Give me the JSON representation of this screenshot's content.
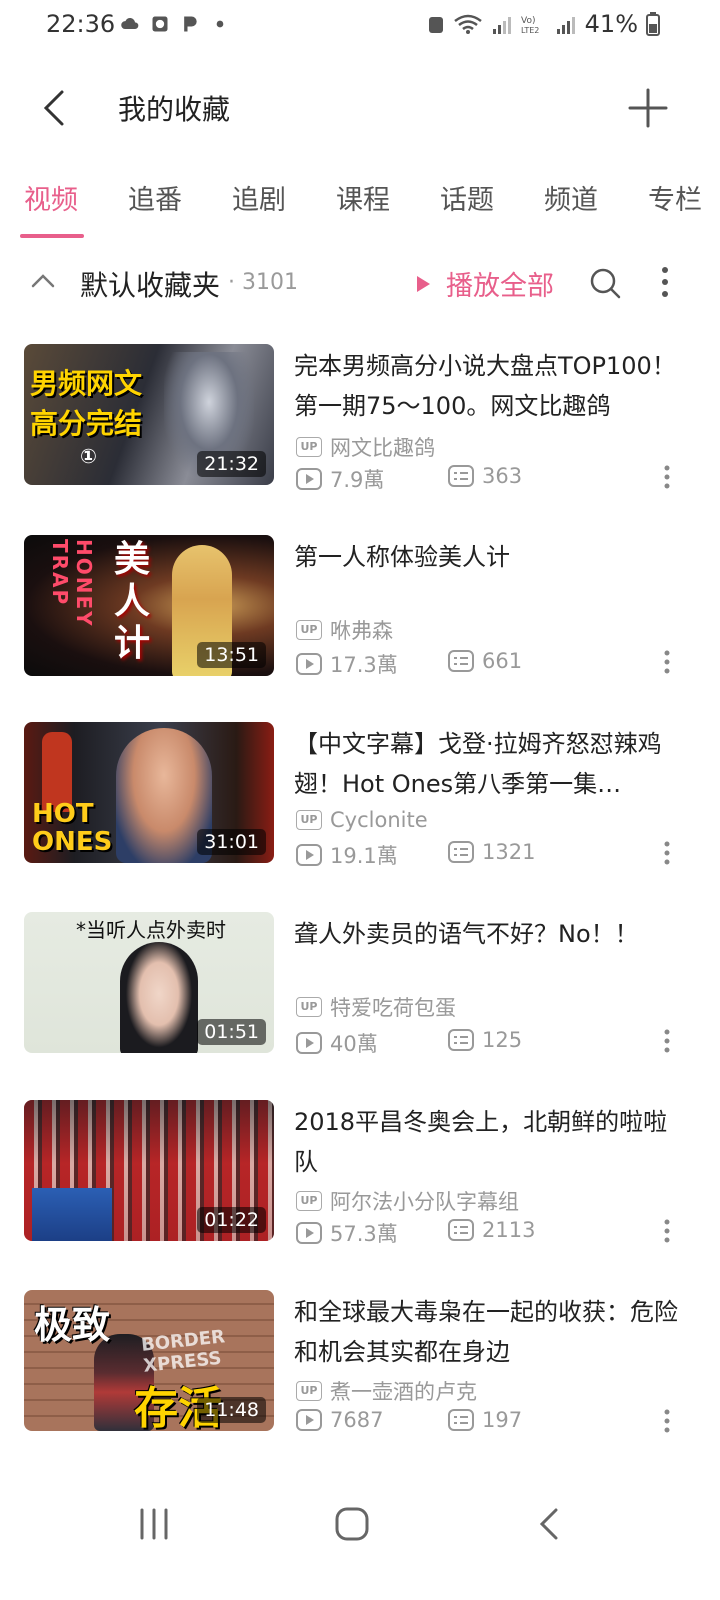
{
  "status_bar": {
    "time": "22:36",
    "battery": "41%",
    "left_icons": [
      "cloud-icon",
      "clock-app-icon",
      "p-app-icon",
      "dot-icon"
    ],
    "right_icons": [
      "alarm-icon",
      "wifi-icon",
      "signal-r-icon",
      "volte-icon",
      "signal-icon",
      "battery-icon"
    ]
  },
  "header": {
    "title": "我的收藏"
  },
  "tabs": [
    {
      "label": "视频",
      "active": true
    },
    {
      "label": "追番",
      "active": false
    },
    {
      "label": "追剧",
      "active": false
    },
    {
      "label": "课程",
      "active": false
    },
    {
      "label": "话题",
      "active": false
    },
    {
      "label": "频道",
      "active": false
    },
    {
      "label": "专栏",
      "active": false
    }
  ],
  "folder": {
    "name": "默认收藏夹",
    "count": "· 3101",
    "play_all": "播放全部"
  },
  "videos": [
    {
      "title": "完本男频高分小说大盘点TOP100！第一期75～100。网文比趣鸽",
      "up": "网文比趣鸽",
      "views": "7.9萬",
      "comments": "363",
      "duration": "21:32"
    },
    {
      "title": "第一人称体验美人计",
      "up": "咻弗森",
      "views": "17.3萬",
      "comments": "661",
      "duration": "13:51"
    },
    {
      "title": "【中文字幕】戈登·拉姆齐怒怼辣鸡翅！Hot Ones第八季第一集…",
      "up": "Cyclonite",
      "views": "19.1萬",
      "comments": "1321",
      "duration": "31:01"
    },
    {
      "title": "聋人外卖员的语气不好？No！！",
      "up": "特爱吃荷包蛋",
      "views": "40萬",
      "comments": "125",
      "duration": "01:51"
    },
    {
      "title": "2018平昌冬奥会上，北朝鲜的啦啦队",
      "up": "阿尔法小分队字幕组",
      "views": "57.3萬",
      "comments": "2113",
      "duration": "01:22"
    },
    {
      "title": "和全球最大毒枭在一起的收获：危险和机会其实都在身边",
      "up": "煮一壶酒的卢克",
      "views": "7687",
      "comments": "197",
      "duration": "11:48"
    }
  ],
  "thumb_texts": {
    "t1_line1": "男频网文",
    "t1_line2": "高分完结",
    "t1_mark": "①",
    "t2_big": "美人计",
    "t2_vertical": "HONEY TRAP",
    "t3_logo": "HOT ONES",
    "t4_caption": "*当听人点外卖时",
    "t6_top": "极致",
    "t6_bottom": "存活",
    "t6_sign": "BORDER XPRESS"
  },
  "colors": {
    "accent": "#e85f8b",
    "text_primary": "#222222",
    "text_secondary": "#999999"
  },
  "nav_bar": {
    "icons": [
      "recents-icon",
      "home-icon",
      "back-nav-icon"
    ]
  }
}
